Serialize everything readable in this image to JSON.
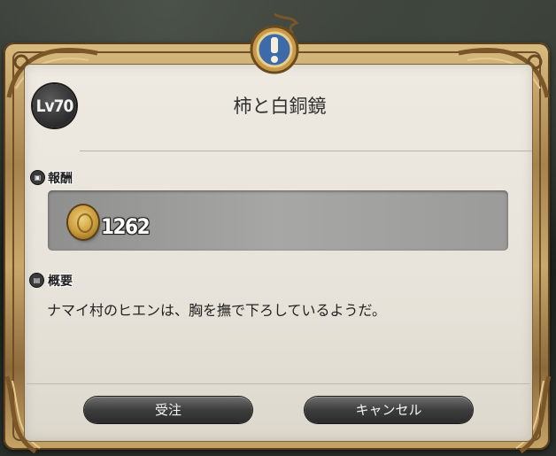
{
  "dialog": {
    "level_badge": "Lv70",
    "title": "柿と白銅鏡",
    "reward": {
      "label": "報酬",
      "amount": "1262",
      "icon": "gil-coin-icon"
    },
    "overview": {
      "label": "概要",
      "text": "ナマイ村のヒエンは、胸を撫で下ろしているようだ。"
    },
    "buttons": {
      "accept": "受注",
      "cancel": "キャンセル"
    }
  },
  "colors": {
    "frame_gold": "#c6a466",
    "panel": "#e9e5dc",
    "button_dark": "#3d3d3d"
  }
}
